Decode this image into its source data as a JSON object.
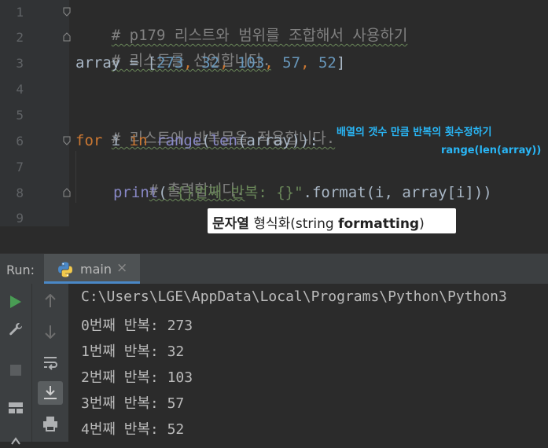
{
  "editor": {
    "line_numbers": [
      "1",
      "2",
      "3",
      "4",
      "5",
      "6",
      "7",
      "8",
      "9"
    ],
    "line1_comment": "# p179 리스트와 범위를 조합해서 사용하기",
    "line2_comment": "# 리스트를 선언합니다.",
    "line3": {
      "var": "array = [",
      "n1": "273",
      "n2": "32",
      "n3": "103",
      "n4": "57",
      "n5": "52",
      "close": "]",
      "sep": ", "
    },
    "line5_comment": "# 리스트에 반복문을 적용합니다.",
    "line6": {
      "kw_for": "for",
      "var_i": " i ",
      "kw_in": "in",
      "range": "range",
      "paren_open": "(",
      "len": "len",
      "rest": "(array)):"
    },
    "line7_comment": "# 출력합니다.",
    "line8": {
      "print": "print",
      "paren": "(",
      "str": "\"{}번째 반복: {}\"",
      "rest": ".format(i, array[i]))"
    }
  },
  "annotations": {
    "cyan_line1": "배열의 갯수 만큼 반복의 횟수정하기",
    "cyan_line2": "range(len(array))",
    "box_bold1": "문자열",
    "box_normal1": " 형식화",
    "box_normal2": "(string ",
    "box_bold2": "formatting",
    "box_normal3": ")"
  },
  "run_panel": {
    "label": "Run:",
    "tab_name": "main",
    "close": "×",
    "output": [
      "C:\\Users\\LGE\\AppData\\Local\\Programs\\Python\\Python3",
      "0번째 반복: 273",
      "1번째 반복: 32",
      "2번째 반복: 103",
      "3번째 반복: 57",
      "4번째 반복: 52"
    ]
  },
  "colors": {
    "accent": "#4a88c7",
    "annotation": "#29b6f6"
  }
}
